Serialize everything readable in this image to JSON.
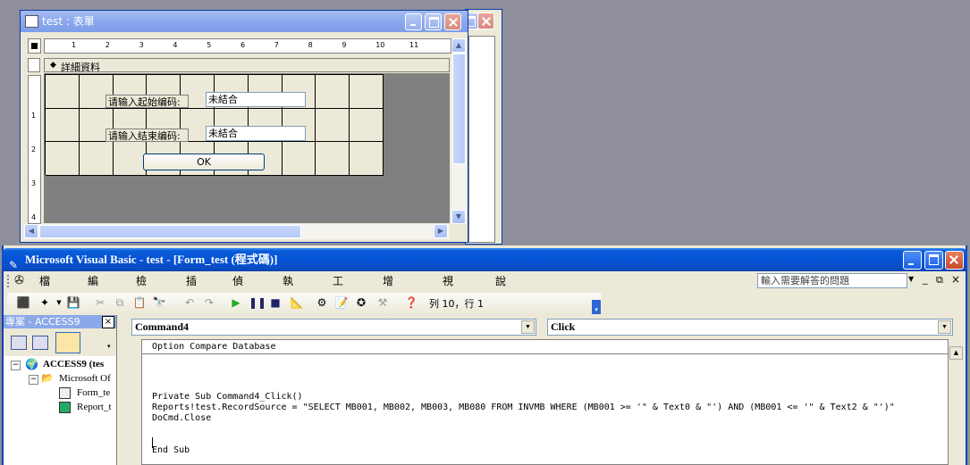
{
  "form_window": {
    "title": "test : 表單",
    "section_label": "詳細資料",
    "ruler_marks": [
      "1",
      "2",
      "3",
      "4",
      "5",
      "6",
      "7",
      "8",
      "9",
      "10",
      "11"
    ],
    "vruler_marks": [
      "1",
      "2",
      "3",
      "4"
    ],
    "label_start": "请输入起始编码:",
    "value_start": "未結合",
    "label_end": "请输入结束编码:",
    "value_end": "未結合",
    "ok_label": "OK"
  },
  "vbe_window": {
    "title": "Microsoft Visual Basic - test - [Form_test (程式碼)]",
    "menu": [
      "檔案(F)",
      "編輯(E)",
      "檢視(V)",
      "插入(I)",
      "偵錯(D)",
      "執行(R)",
      "工具(T)",
      "增益集(A)",
      "視窗(W)",
      "說明(H)"
    ],
    "help_placeholder": "輸入需要解答的問題",
    "cursor_position": "列 10，行 1",
    "project_pane": {
      "title": "專案 - ACCESS9",
      "tree": [
        "ACCESS9 (tes",
        "Microsoft Of",
        "Form_te",
        "Report_t"
      ]
    },
    "object_combo": "Command4",
    "procedure_combo": "Click",
    "code_lines": [
      "Option Compare Database",
      "",
      "",
      "Private Sub Command4_Click()",
      "Reports!test.RecordSource = \"SELECT MB001, MB002, MB003, MB080 FROM INVMB WHERE (MB001 >= '\" & Text0 & \"') AND (MB001 <= '\" & Text2 & \"')\"",
      "DoCmd.Close",
      "",
      "",
      "End Sub"
    ]
  }
}
